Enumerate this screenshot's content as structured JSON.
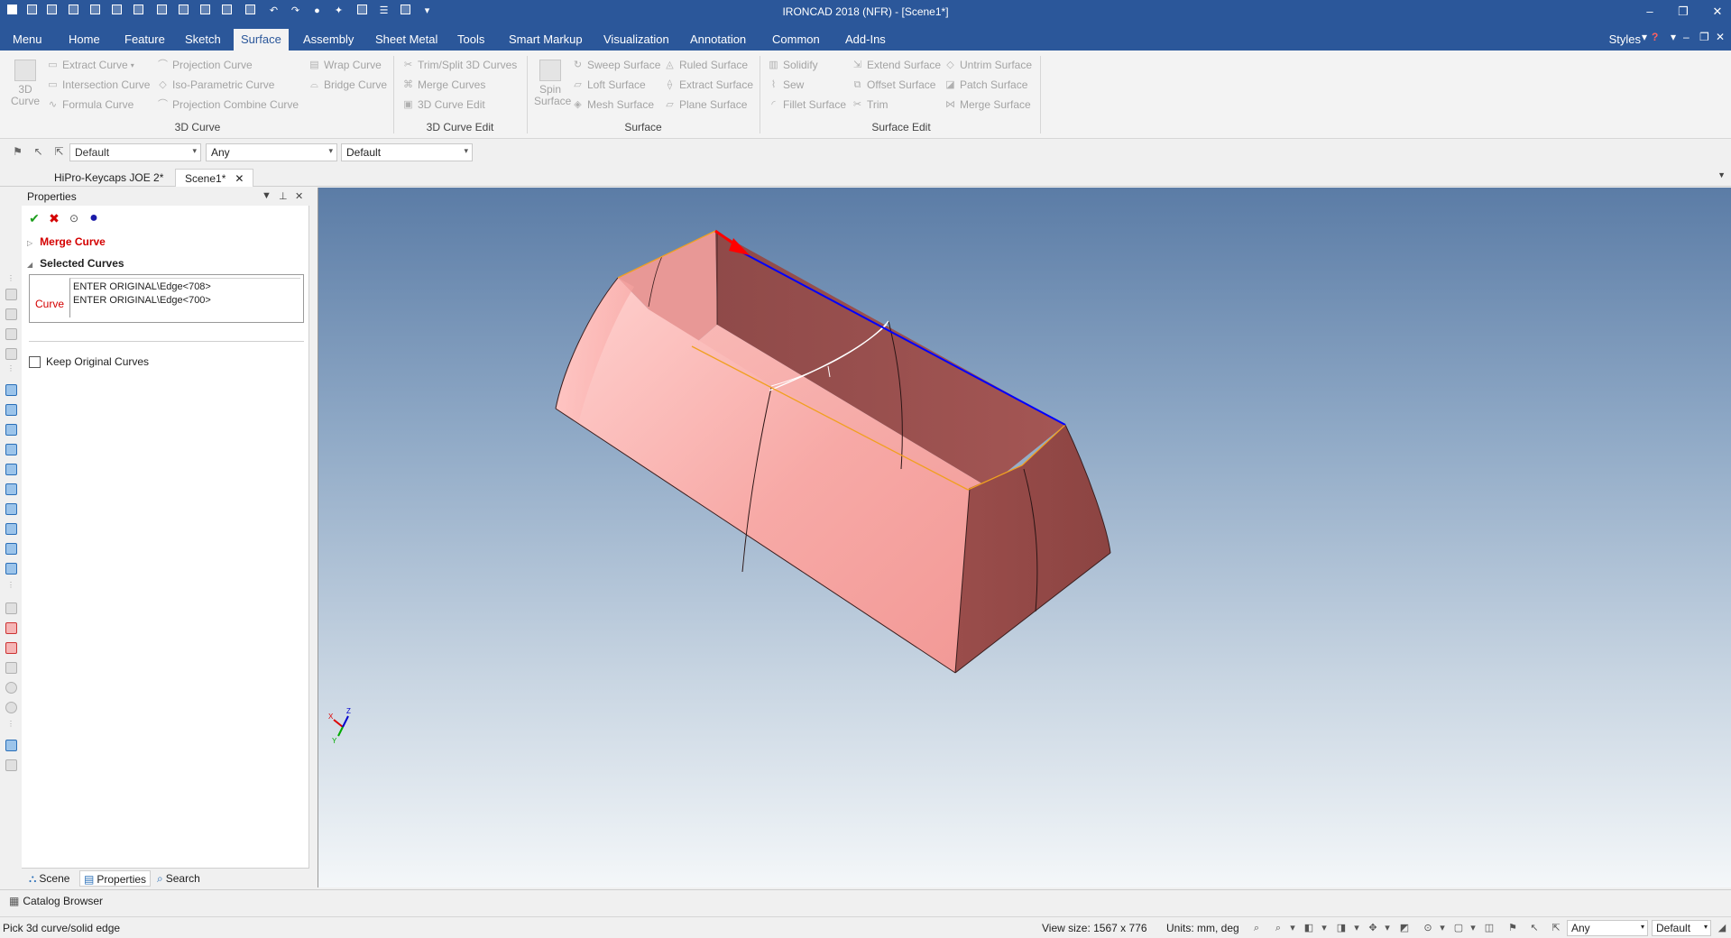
{
  "window": {
    "title": "IRONCAD 2018 (NFR) - [Scene1*]",
    "controls": {
      "minimize": "–",
      "restore": "❐",
      "close": "✕"
    }
  },
  "menu_tabs": [
    "Menu",
    "Home",
    "Feature",
    "Sketch",
    "Surface",
    "Assembly",
    "Sheet Metal",
    "Tools",
    "Smart Markup",
    "Visualization",
    "Annotation",
    "Common",
    "Add-Ins"
  ],
  "active_menu_tab": "Surface",
  "styles_label": "Styles",
  "ribbon": {
    "curve_3d_button": [
      "3D",
      "Curve"
    ],
    "curve_3d_items": [
      "Extract Curve",
      "Intersection Curve",
      "Formula Curve",
      "Projection Curve",
      "Iso-Parametric Curve",
      "Projection Combine Curve",
      "Wrap Curve",
      "Bridge Curve"
    ],
    "curve_edit_items": [
      "Trim/Split 3D Curves",
      "Merge Curves",
      "3D Curve Edit"
    ],
    "spin_surface_button": [
      "Spin",
      "Surface"
    ],
    "surface_items": [
      "Sweep Surface",
      "Loft Surface",
      "Mesh Surface",
      "Ruled Surface",
      "Extract Surface",
      "Plane Surface"
    ],
    "surface_edit_items": [
      "Solidify",
      "Sew",
      "Fillet Surface",
      "Extend Surface",
      "Offset Surface",
      "Trim",
      "Untrim Surface",
      "Patch Surface",
      "Merge Surface"
    ],
    "group_labels": [
      "3D Curve",
      "3D Curve Edit",
      "Surface",
      "Surface Edit"
    ]
  },
  "toolbar2": {
    "combo1": "Default",
    "combo2": "Any",
    "combo3": "Default"
  },
  "doc_tabs": [
    "HiPro-Keycaps JOE 2*",
    "Scene1*"
  ],
  "doc_tab_close": "✕",
  "properties": {
    "header": "Properties",
    "merge_title": "Merge Curve",
    "selected_title": "Selected Curves",
    "curve_label": "Curve",
    "curves": [
      "ENTER ORIGINAL\\Edge<708>",
      "ENTER ORIGINAL\\Edge<700>"
    ],
    "keep_original": "Keep Original Curves"
  },
  "panel_tabs": [
    "Scene",
    "Properties",
    "Search"
  ],
  "catalog_browser": "Catalog Browser",
  "axes": {
    "x": "X",
    "y": "Y",
    "z": "Z"
  },
  "status": {
    "message": "Pick 3d curve/solid edge",
    "view_size": "View size: 1567 x  776",
    "units": "Units: mm, deg",
    "combo_any": "Any",
    "combo_default": "Default"
  },
  "colors": {
    "titlebar": "#2b579a",
    "accent_red": "#d40000",
    "solid_light": "#f5a6a4",
    "solid_dark": "#9e4e4c",
    "edge_blue": "#0000ff",
    "edge_orange": "#f0a020"
  }
}
